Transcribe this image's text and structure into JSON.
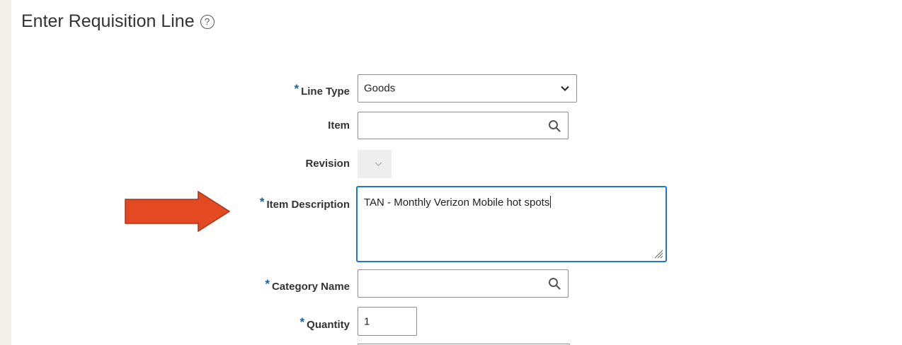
{
  "page": {
    "title": "Enter Requisition Line",
    "help_icon_glyph": "?"
  },
  "form": {
    "line_type": {
      "label": "Line Type",
      "required": "*",
      "value": "Goods"
    },
    "item": {
      "label": "Item",
      "value": ""
    },
    "revision": {
      "label": "Revision",
      "value": ""
    },
    "item_description": {
      "label": "Item Description",
      "required": "*",
      "value": "TAN - Monthly Verizon Mobile hot spots"
    },
    "category_name": {
      "label": "Category Name",
      "required": "*",
      "value": ""
    },
    "quantity": {
      "label": "Quantity",
      "required": "*",
      "value": "1"
    }
  },
  "colors": {
    "required_marker": "#1f5f9a",
    "focus_border": "#1e78c8",
    "annotation_arrow": "#e34a22",
    "annotation_arrow_outline": "#a8341a"
  },
  "icons": {
    "help": "help-circle-icon",
    "dropdown": "chevron-down-icon",
    "search": "search-icon",
    "resize": "resize-grip-icon",
    "annotation": "arrow-right-icon"
  }
}
